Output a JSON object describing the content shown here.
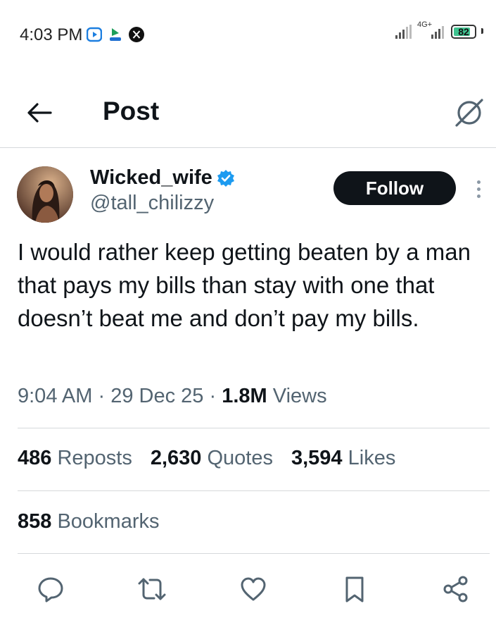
{
  "status_bar": {
    "time": "4:03 PM",
    "network_label": "4G+",
    "battery": "82",
    "battery_level_percent": 82,
    "app_icons": [
      "video-app-icon",
      "shop-app-icon",
      "x-app-icon"
    ]
  },
  "header": {
    "title": "Post",
    "back_icon": "arrow-left-icon",
    "grok_icon": "grok-icon"
  },
  "author": {
    "display_name": "Wicked_wife",
    "handle": "@tall_chilizzy",
    "verified": true,
    "follow_label": "Follow"
  },
  "tweet": {
    "text": "I would rather keep getting beaten by a man that pays my bills than stay with one that doesn’t beat me and don’t pay my bills.",
    "time": "9:04 AM",
    "date": "29 Dec 25",
    "separator": "·",
    "views_count": "1.8M",
    "views_label": "Views"
  },
  "stats": {
    "reposts_count": "486",
    "reposts_label": "Reposts",
    "quotes_count": "2,630",
    "quotes_label": "Quotes",
    "likes_count": "3,594",
    "likes_label": "Likes",
    "bookmarks_count": "858",
    "bookmarks_label": "Bookmarks"
  },
  "actions": [
    "reply-icon",
    "repost-icon",
    "like-icon",
    "bookmark-icon",
    "share-icon"
  ],
  "colors": {
    "text_primary": "#0f1419",
    "text_secondary": "#536471",
    "verified_blue": "#1d9bf0",
    "divider": "#d6d9db",
    "follow_bg": "#0f1419"
  }
}
